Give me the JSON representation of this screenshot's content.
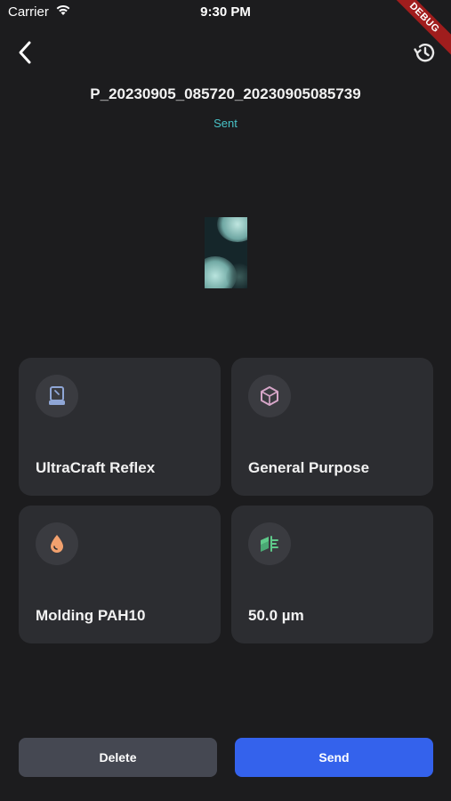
{
  "status_bar": {
    "carrier": "Carrier",
    "time": "9:30 PM"
  },
  "debug_banner": "DEBUG",
  "file": {
    "name": "P_20230905_085720_20230905085739",
    "status": "Sent"
  },
  "cards": [
    {
      "label": "UltraCraft Reflex",
      "icon": "printer-icon",
      "color": "#8fa6d6"
    },
    {
      "label": "General Purpose",
      "icon": "cube-icon",
      "color": "#d6a6c8"
    },
    {
      "label": "Molding PAH10",
      "icon": "droplet-icon",
      "color": "#f2a16e"
    },
    {
      "label": "50.0 µm",
      "icon": "layers-icon",
      "color": "#5fc98a"
    }
  ],
  "actions": {
    "delete_label": "Delete",
    "send_label": "Send"
  },
  "colors": {
    "background": "#1c1c1e",
    "card": "#2c2d31",
    "accent": "#3462ec",
    "status": "#48c2c7",
    "delete_bg": "#454852"
  }
}
